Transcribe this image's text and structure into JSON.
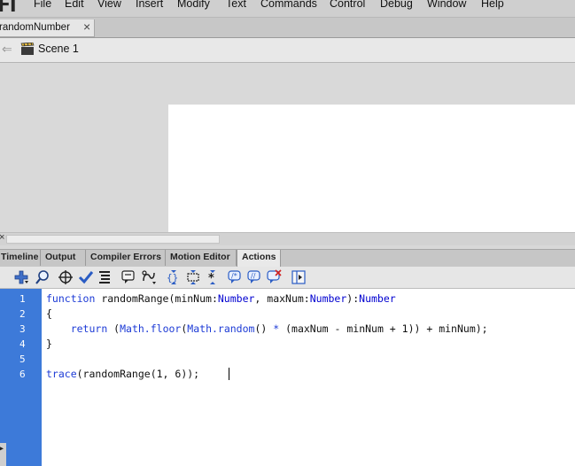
{
  "app": {
    "logo": "Fl"
  },
  "menu": [
    "File",
    "Edit",
    "View",
    "Insert",
    "Modify",
    "Text",
    "Commands",
    "Control",
    "Debug",
    "Window",
    "Help"
  ],
  "document_tab": {
    "label": "randomNumber",
    "close": "×"
  },
  "editbar": {
    "scene_label": "Scene 1"
  },
  "panel_tabs": [
    "Timeline",
    "Output",
    "Compiler Errors",
    "Motion Editor",
    "Actions"
  ],
  "active_panel": "Actions",
  "toolbar_icons": [
    "add-statement-icon",
    "find-icon",
    "insert-target-path-icon",
    "check-syntax-icon",
    "auto-format-icon",
    "show-code-hint-icon",
    "debug-options-icon",
    "collapse-between-braces-icon",
    "collapse-selection-icon",
    "expand-all-icon",
    "apply-block-comment-icon",
    "apply-line-comment-icon",
    "remove-comment-icon",
    "show-hide-toolbox-icon"
  ],
  "code": {
    "line_numbers": [
      "1",
      "2",
      "3",
      "4",
      "5",
      "6"
    ],
    "lines": [
      "function randomRange(minNum:Number, maxNum:Number):Number",
      "{",
      "    return (Math.floor(Math.random() * (maxNum - minNum + 1)) + minNum);",
      "}",
      "",
      "trace(randomRange(1, 6));"
    ]
  },
  "colors": {
    "gutter": "#3d7ad9",
    "keyword": "#1d3bd6",
    "type": "#0000d0"
  }
}
